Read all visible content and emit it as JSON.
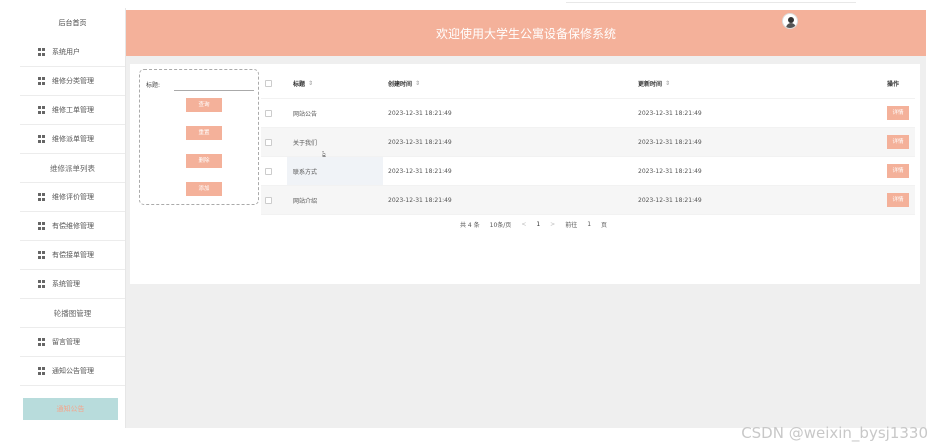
{
  "sidebar": {
    "home": "后台首页",
    "items": [
      {
        "label": "系统用户",
        "icon": true
      },
      {
        "label": "维修分类管理",
        "icon": true
      },
      {
        "label": "维修工单管理",
        "icon": true
      },
      {
        "label": "维修派单管理",
        "icon": true
      },
      {
        "label": "维修派单列表",
        "icon": false
      },
      {
        "label": "维修评价管理",
        "icon": true
      },
      {
        "label": "有偿维修管理",
        "icon": true
      },
      {
        "label": "有偿接单管理",
        "icon": true
      },
      {
        "label": "系统管理",
        "icon": true
      },
      {
        "label": "轮播图管理",
        "icon": false
      },
      {
        "label": "留言管理",
        "icon": true
      },
      {
        "label": "通知公告管理",
        "icon": true
      }
    ],
    "active": "通知公告"
  },
  "header": {
    "title": "欢迎使用大学生公寓设备保修系统"
  },
  "search": {
    "label": "标题:",
    "value": "",
    "buttons": [
      "查询",
      "重置",
      "删除",
      "添加"
    ]
  },
  "table": {
    "columns": {
      "title": "标题",
      "create": "创建时间",
      "update": "更新时间",
      "op": "操作"
    },
    "sort_glyph": "⇕",
    "rows": [
      {
        "title": "网站公告",
        "create": "2023-12-31 18:21:49",
        "update": "2023-12-31 18:21:49",
        "op": "详情"
      },
      {
        "title": "关于我们",
        "create": "2023-12-31 18:21:49",
        "update": "2023-12-31 18:21:49",
        "op": "详情"
      },
      {
        "title": "联系方式",
        "create": "2023-12-31 18:21:49",
        "update": "2023-12-31 18:21:49",
        "op": "详情"
      },
      {
        "title": "网站介绍",
        "create": "2023-12-31 18:21:49",
        "update": "2023-12-31 18:21:49",
        "op": "详情"
      }
    ]
  },
  "pager": {
    "total": "共 4 条",
    "size": "10条/页",
    "prev": "<",
    "current": "1",
    "next": ">",
    "goto": "前往",
    "page": "1",
    "unit": "页"
  },
  "watermark": "CSDN @weixin_bysj1330",
  "colors": {
    "accent": "#f4b19a",
    "active_bg": "#b8dcdc",
    "content_bg": "#efefef"
  }
}
